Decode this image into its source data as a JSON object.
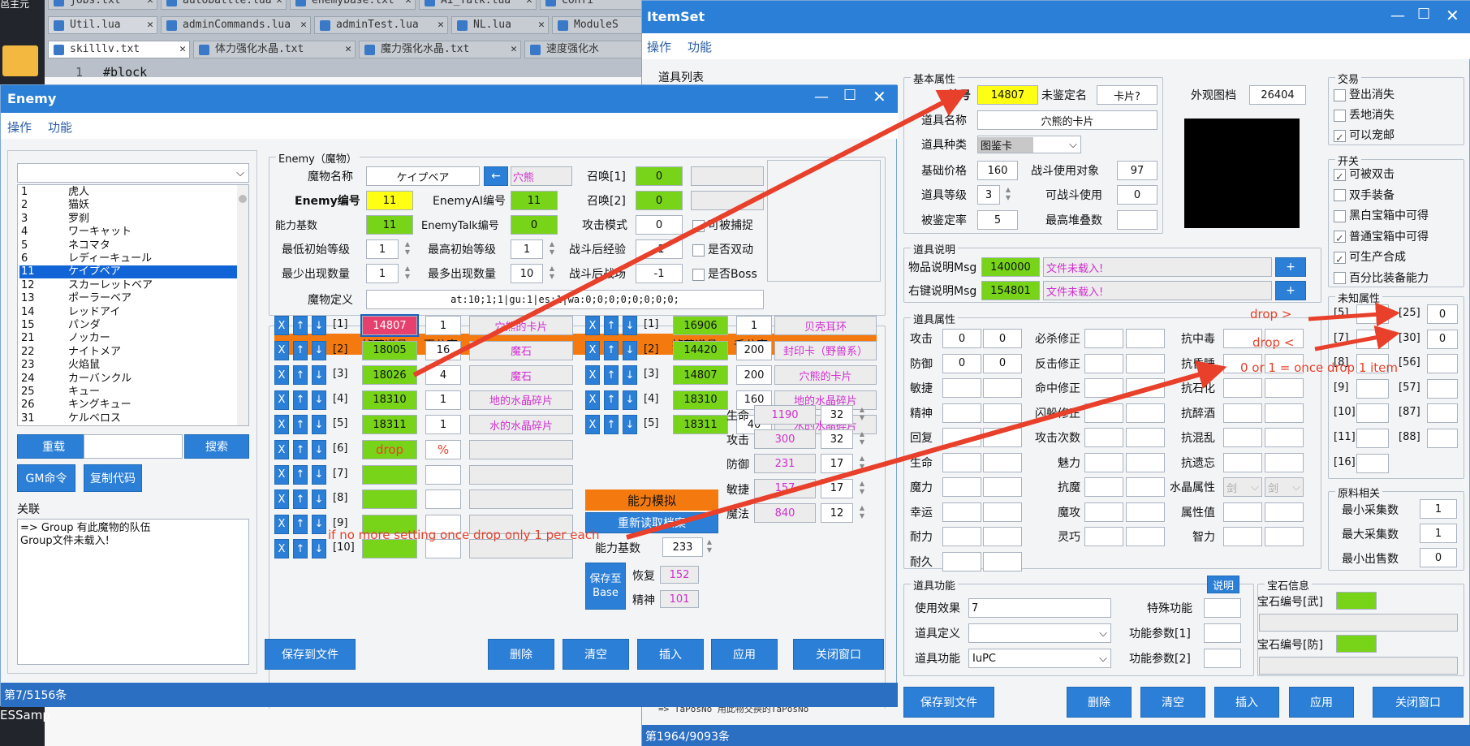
{
  "editor": {
    "tabs_row1": [
      "jobs.txt",
      "autobattle.lua",
      "enemybase.txt",
      "AI_Talk.lua",
      "Confi"
    ],
    "tabs_row2": [
      "Util.lua",
      "adminCommands.lua",
      "adminTest.lua",
      "NL.lua",
      "ModuleS"
    ],
    "tabs_row3": [
      "skilllv.txt",
      "体力强化水晶.txt",
      "魔力强化水晶.txt",
      "速度强化水"
    ],
    "line_number": "1",
    "line_text": "#block",
    "corner_text": "邑主元",
    "bottom_text": "ESSamp"
  },
  "enemy": {
    "title": "Enemy",
    "menu": [
      "操作",
      "功能"
    ],
    "list": [
      [
        "1",
        "虎人"
      ],
      [
        "2",
        "猫妖"
      ],
      [
        "3",
        "罗刹"
      ],
      [
        "4",
        "ワーキャット"
      ],
      [
        "5",
        "ネコマタ"
      ],
      [
        "6",
        "レディーキュール"
      ],
      [
        "11",
        "ケイプベア"
      ],
      [
        "12",
        "スカーレットベア"
      ],
      [
        "13",
        "ポーラーベア"
      ],
      [
        "14",
        "レッドアイ"
      ],
      [
        "15",
        "パンダ"
      ],
      [
        "21",
        "ノッカー"
      ],
      [
        "22",
        "ナイトメア"
      ],
      [
        "23",
        "火焰鼠"
      ],
      [
        "24",
        "カーバンクル"
      ],
      [
        "25",
        "キュー"
      ],
      [
        "26",
        "キングキュー"
      ],
      [
        "31",
        "ケルベロス"
      ]
    ],
    "selected_index": 6,
    "btn_reload": "重载",
    "btn_search": "搜索",
    "btn_gm": "GM命令",
    "btn_copy": "复制代码",
    "related_label": "关联",
    "related_text": "=> Group 有此魔物的队伍\nGroup文件未载入!",
    "group_title": "Enemy（魔物）",
    "name_label": "魔物名称",
    "name_value": "ケイプベア",
    "arrow": "←",
    "name_cn": "穴熊",
    "id_label": "Enemy编号",
    "id_value": "11",
    "ai_label": "EnemyAI编号",
    "ai_value": "11",
    "base_label": "能力基数",
    "base_value": "11",
    "talk_label": "EnemyTalk编号",
    "talk_value": "0",
    "summon1_label": "召唤[1]",
    "summon1_value": "0",
    "summon2_label": "召唤[2]",
    "summon2_value": "0",
    "attack_mode_label": "攻击模式",
    "attack_mode_value": "0",
    "capture_label": "可被捕捉",
    "min_lv_label": "最低初始等级",
    "min_lv_value": "1",
    "max_lv_label": "最高初始等级",
    "max_lv_value": "1",
    "exp_label": "战斗后经验",
    "exp_value": "-1",
    "double_label": "是否双动",
    "min_cnt_label": "最少出现数量",
    "min_cnt_value": "1",
    "max_cnt_label": "最多出现数量",
    "max_cnt_value": "10",
    "after_label": "战斗后战场",
    "after_value": "-1",
    "boss_label": "是否Boss",
    "define_label": "魔物定义",
    "define_value": "at:10;1;1|gu:1|es:1|wa:0;0;0;0;0;0;0;0;",
    "drop_header_left": [
      "掉落道具",
      "百分率"
    ],
    "drop_header_right": [
      "掉落道具",
      "千分率"
    ],
    "drops_left": [
      {
        "idx": "[1]",
        "id": "14807",
        "rate": "1",
        "name": "穴熊的卡片"
      },
      {
        "idx": "[2]",
        "id": "18005",
        "rate": "16",
        "name": "魔石"
      },
      {
        "idx": "[3]",
        "id": "18026",
        "rate": "4",
        "name": "魔石"
      },
      {
        "idx": "[4]",
        "id": "18310",
        "rate": "1",
        "name": "地的水晶碎片"
      },
      {
        "idx": "[5]",
        "id": "18311",
        "rate": "1",
        "name": "水的水晶碎片"
      },
      {
        "idx": "[6]",
        "id": "drop",
        "rate": "%",
        "name": ""
      },
      {
        "idx": "[7]",
        "id": "",
        "rate": "",
        "name": ""
      },
      {
        "idx": "[8]",
        "id": "",
        "rate": "",
        "name": ""
      },
      {
        "idx": "[9]",
        "id": "",
        "rate": "",
        "name": ""
      },
      {
        "idx": "[10]",
        "id": "",
        "rate": "",
        "name": ""
      }
    ],
    "drops_right": [
      {
        "idx": "[1]",
        "id": "16906",
        "rate": "1",
        "name": "贝壳耳环"
      },
      {
        "idx": "[2]",
        "id": "14420",
        "rate": "200",
        "name": "封印卡（野兽系）"
      },
      {
        "idx": "[3]",
        "id": "14807",
        "rate": "200",
        "name": "穴熊的卡片"
      },
      {
        "idx": "[4]",
        "id": "18310",
        "rate": "160",
        "name": "地的水晶碎片"
      },
      {
        "idx": "[5]",
        "id": "18311",
        "rate": "40",
        "name": "水的水晶碎片"
      }
    ],
    "sim_btn": "能力模拟",
    "reload_btn": "重新读取档案",
    "base_num": "233",
    "save_base": "保存至\nBase",
    "stats": [
      {
        "l": "生命",
        "v": "1190",
        "n": "32"
      },
      {
        "l": "攻击",
        "v": "300",
        "n": "32"
      },
      {
        "l": "防御",
        "v": "231",
        "n": "17"
      },
      {
        "l": "敏捷",
        "v": "157",
        "n": "17"
      },
      {
        "l": "魔法",
        "v": "840",
        "n": "12"
      }
    ],
    "stat_recover": {
      "l": "恢复",
      "v": "152"
    },
    "stat_spirit": {
      "l": "精神",
      "v": "101"
    },
    "bottom": [
      "保存到文件",
      "删除",
      "清空",
      "插入",
      "应用",
      "关闭窗口"
    ],
    "status": "第7/5156条"
  },
  "itemset": {
    "title": "ItemSet",
    "menu": [
      "操作",
      "功能"
    ],
    "list_label": "道具列表",
    "basic_title": "基本属性",
    "id_label": "编号",
    "id_value": "14807",
    "unid_label": "未鉴定名",
    "unid_value": "卡片?",
    "look_label": "外观图档",
    "look_value": "26404",
    "name_label": "道具名称",
    "name_value": "穴熊的卡片",
    "type_label": "道具种类",
    "type_value": "图鉴卡",
    "price_label": "基础价格",
    "price_value": "160",
    "target_label": "战斗使用对象",
    "target_value": "97",
    "level_label": "道具等级",
    "level_value": "3",
    "battle_use_label": "可战斗使用",
    "battle_use_value": "0",
    "rate_label": "被鉴定率",
    "rate_value": "5",
    "stack_label": "最高堆叠数",
    "stack_value": "",
    "trade_title": "交易",
    "trade": [
      {
        "t": "登出消失",
        "on": false
      },
      {
        "t": "丢地消失",
        "on": false
      },
      {
        "t": "可以宠邮",
        "on": true
      }
    ],
    "switch_title": "开关",
    "switches": [
      {
        "t": "可被双击",
        "on": true
      },
      {
        "t": "双手装备",
        "on": false
      },
      {
        "t": "黑白宝箱中可得",
        "on": false
      },
      {
        "t": "普通宝箱中可得",
        "on": true
      },
      {
        "t": "可生产合成",
        "on": true
      },
      {
        "t": "百分比装备能力",
        "on": false
      }
    ],
    "desc_title": "道具说明",
    "msg1_label": "物品说明Msg",
    "msg1_value": "140000",
    "msg1_text": "文件未载入!",
    "msg2_label": "右键说明Msg",
    "msg2_value": "154801",
    "msg2_text": "文件未载入!",
    "attr_title": "道具属性",
    "attr_col1": [
      "攻击",
      "防御",
      "敏捷",
      "精神",
      "回复",
      "生命",
      "魔力",
      "幸运",
      "耐力",
      "耐久"
    ],
    "attr_col2": [
      "必杀修正",
      "反击修正",
      "命中修正",
      "闪躲修正",
      "攻击次数",
      "魅力",
      "抗魔",
      "魔攻",
      "灵巧"
    ],
    "attr_col3": [
      "抗中毒",
      "抗昏睡",
      "抗石化",
      "抗醉酒",
      "抗混乱",
      "抗遗忘",
      "水晶属性",
      "属性值",
      "智力"
    ],
    "atk_values": [
      "0",
      "0"
    ],
    "def_values": [
      "0",
      "0"
    ],
    "crystal_opts": [
      "剑",
      "剑"
    ],
    "unknown_title": "未知属性",
    "unknown_left": [
      "[5]",
      "[7]",
      "[8]",
      "[9]",
      "[10]",
      "[11]",
      "[16]"
    ],
    "unknown_right": [
      {
        "k": "[25]",
        "v": "0"
      },
      {
        "k": "[30]",
        "v": "0"
      },
      {
        "k": "[56]",
        "v": ""
      },
      {
        "k": "[57]",
        "v": ""
      },
      {
        "k": "[87]",
        "v": ""
      },
      {
        "k": "[88]",
        "v": ""
      }
    ],
    "material_title": "原料相关",
    "materials": [
      {
        "l": "最小采集数",
        "v": "1"
      },
      {
        "l": "最大采集数",
        "v": "1"
      },
      {
        "l": "最小出售数",
        "v": "0"
      }
    ],
    "func_title": "道具功能",
    "func_help": "说明",
    "use_label": "使用效果",
    "use_value": "7",
    "special_label": "特殊功能",
    "def_label": "道具定义",
    "param1_label": "功能参数[1]",
    "func_label": "道具功能",
    "func_value": "IuPC",
    "param2_label": "功能参数[2]",
    "gem_title": "宝石信息",
    "gem_atk": "宝石编号[武]",
    "gem_def": "宝石编号[防]",
    "bottom": [
      "保存到文件",
      "删除",
      "清空",
      "插入",
      "应用",
      "关闭窗口"
    ],
    "status": "第1964/9093条",
    "partial_text": "=> TaPosNo 用此物交换的TaPosNo"
  },
  "annotations": {
    "drop_gt": "drop >",
    "drop_lt": "drop <",
    "once": "0 or 1 = once drop 1 item",
    "no_more": "if no more setting once drop only 1 per each"
  }
}
